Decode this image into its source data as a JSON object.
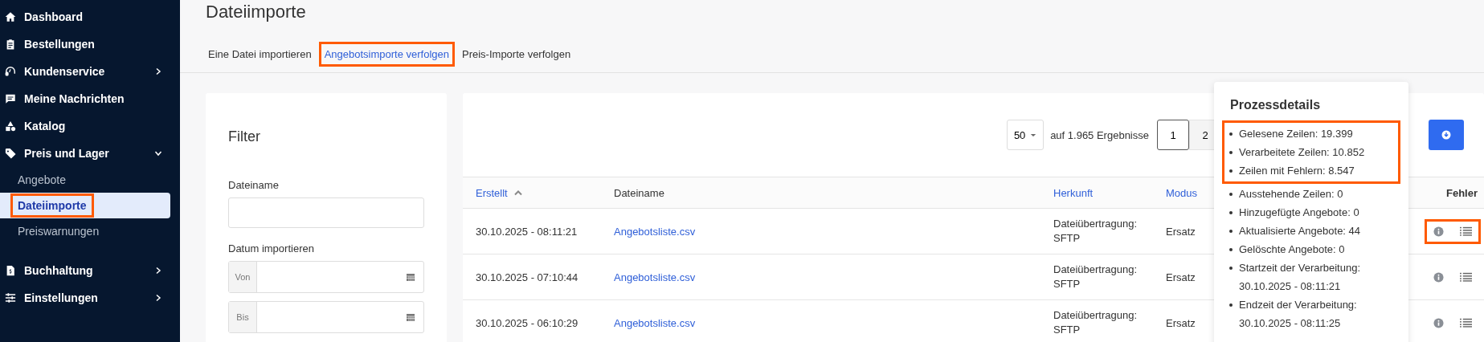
{
  "sidebar": {
    "items": [
      {
        "label": "Dashboard"
      },
      {
        "label": "Bestellungen"
      },
      {
        "label": "Kundenservice",
        "expanded": false
      },
      {
        "label": "Meine Nachrichten"
      },
      {
        "label": "Katalog"
      },
      {
        "label": "Preis und Lager",
        "expanded": true,
        "children": [
          {
            "label": "Angebote",
            "selected": false,
            "highlighted": false
          },
          {
            "label": "Dateiimporte",
            "selected": true,
            "highlighted": true
          },
          {
            "label": "Preiswarnungen",
            "selected": false,
            "highlighted": false
          }
        ]
      },
      {
        "label": "Buchhaltung",
        "expanded": false
      },
      {
        "label": "Einstellungen",
        "expanded": false
      }
    ]
  },
  "page_title": "Dateiimporte",
  "tabs": [
    {
      "label": "Eine Datei importieren",
      "selected": false,
      "highlighted": false
    },
    {
      "label": "Angebotsimporte verfolgen",
      "selected": true,
      "highlighted": true
    },
    {
      "label": "Preis-Importe verfolgen",
      "selected": false,
      "highlighted": false
    }
  ],
  "filter": {
    "title": "Filter",
    "fields": [
      {
        "kind": "text",
        "label": "Dateiname"
      },
      {
        "kind": "daterange",
        "label": "Datum importieren",
        "parts": [
          "Von",
          "Bis"
        ]
      }
    ]
  },
  "pagination": {
    "page_size": "50",
    "results": "auf 1.965 Ergebnisse",
    "pages": [
      {
        "label": "1",
        "selected": true
      },
      {
        "label": "2",
        "selected": false
      }
    ]
  },
  "table": {
    "columns": [
      {
        "label": "Erstellt",
        "sortable": true,
        "sorted": true
      },
      {
        "label": "Dateiname",
        "sortable": false,
        "sorted": false
      },
      {
        "label": "Herkunft",
        "sortable": true,
        "sorted": false
      },
      {
        "label": "Modus",
        "sortable": true,
        "sorted": false
      },
      {
        "label": "Fehler",
        "sortable": false,
        "sorted": false
      }
    ],
    "rows": [
      {
        "created": "30.10.2025 - 08:11:21",
        "file": "Angebotsliste.csv",
        "origin": "Dateiübertragung: SFTP",
        "mode": "Ersatz",
        "actions_highlighted": true
      },
      {
        "created": "30.10.2025 - 07:10:44",
        "file": "Angebotsliste.csv",
        "origin": "Dateiübertragung: SFTP",
        "mode": "Ersatz",
        "actions_highlighted": false
      },
      {
        "created": "30.10.2025 - 06:10:29",
        "file": "Angebotsliste.csv",
        "origin": "Dateiübertragung: SFTP",
        "mode": "Ersatz",
        "actions_highlighted": false
      }
    ]
  },
  "popover": {
    "title": "Prozessdetails",
    "groups": [
      {
        "highlighted": true,
        "items": [
          "Gelesene Zeilen: 19.399",
          "Verarbeitete Zeilen: 10.852",
          "Zeilen mit Fehlern: 8.547"
        ]
      },
      {
        "highlighted": false,
        "items": [
          "Ausstehende Zeilen: 0",
          "Hinzugefügte Angebote: 0",
          "Aktualisierte Angebote: 44",
          "Gelöschte Angebote: 0",
          "Startzeit der Verarbeitung: 30.10.2025 - 08:11:21",
          "Endzeit der Verarbeitung: 30.10.2025 - 08:11:25"
        ]
      }
    ]
  }
}
